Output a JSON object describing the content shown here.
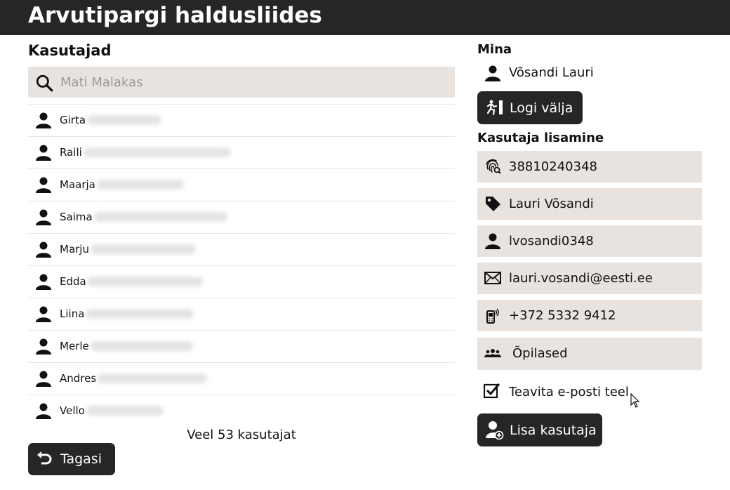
{
  "app": {
    "title": "Arvutipargi haldusliides"
  },
  "users_panel": {
    "heading": "Kasutajad",
    "search": {
      "placeholder": "Mati Malakas",
      "value": "",
      "icon": "search-icon"
    },
    "users": [
      {
        "name": "Girta",
        "icon": "person-icon"
      },
      {
        "name": "Raili",
        "icon": "person-icon"
      },
      {
        "name": "Maarja",
        "icon": "person-icon"
      },
      {
        "name": "Saima",
        "icon": "person-icon"
      },
      {
        "name": "Marju",
        "icon": "person-icon"
      },
      {
        "name": "Edda",
        "icon": "person-icon"
      },
      {
        "name": "Liina",
        "icon": "person-icon"
      },
      {
        "name": "Merle",
        "icon": "person-icon"
      },
      {
        "name": "Andres",
        "icon": "person-icon"
      },
      {
        "name": "Vello",
        "icon": "person-icon"
      }
    ],
    "more_text": "Veel 53 kasutajat",
    "back_button": {
      "label": "Tagasi",
      "icon": "undo-arrow-icon"
    }
  },
  "me": {
    "heading": "Mina",
    "name": "Võsandi Lauri",
    "icon": "person-icon",
    "logout_button": {
      "label": "Logi välja",
      "icon": "exit-run-icon"
    }
  },
  "add_user": {
    "heading": "Kasutaja lisamine",
    "fields": {
      "id_code": {
        "value": "38810240348",
        "icon": "fingerprint-icon"
      },
      "full_name": {
        "value": "Lauri Võsandi",
        "icon": "tag-icon"
      },
      "username": {
        "value": "lvosandi0348",
        "icon": "person-icon"
      },
      "email": {
        "value": "lauri.vosandi@eesti.ee",
        "icon": "envelope-icon"
      },
      "phone": {
        "value": "+372 5332 9412",
        "icon": "mobile-phone-icon"
      },
      "group": {
        "value": "Õpilased",
        "icon": "group-icon"
      }
    },
    "notify": {
      "label": "Teavita e-posti teel",
      "checked": true,
      "icon": "checkbox-checked-icon"
    },
    "submit_button": {
      "label": "Lisa kasutaja",
      "icon": "add-user-icon"
    }
  },
  "colors": {
    "topbar": "#262626",
    "field_bg": "#e8e3df",
    "button": "#262626"
  }
}
